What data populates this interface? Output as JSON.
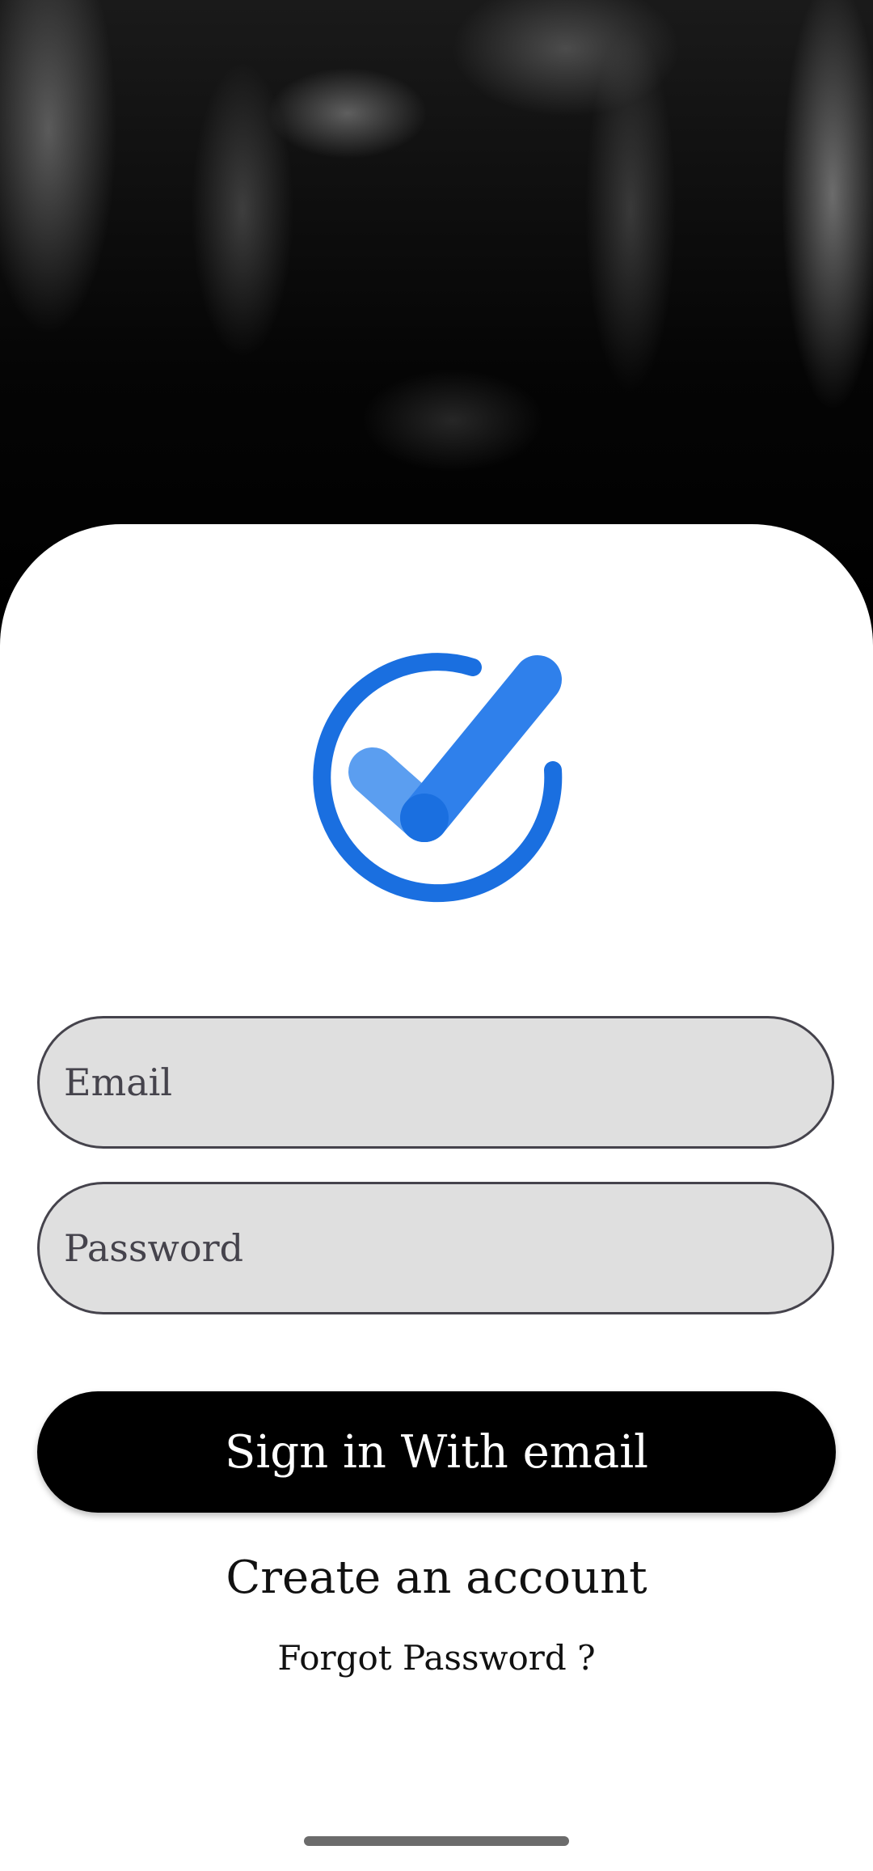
{
  "background": {
    "description_color": "#000000"
  },
  "logo": {
    "icon": "check-circle-icon",
    "accent_color": "#1a6fe0"
  },
  "form": {
    "email_placeholder": "Email",
    "password_placeholder": "Password"
  },
  "actions": {
    "sign_in_label": "Sign in With email",
    "create_account_label": "Create an account",
    "forgot_password_label": "Forgot Password ?"
  }
}
